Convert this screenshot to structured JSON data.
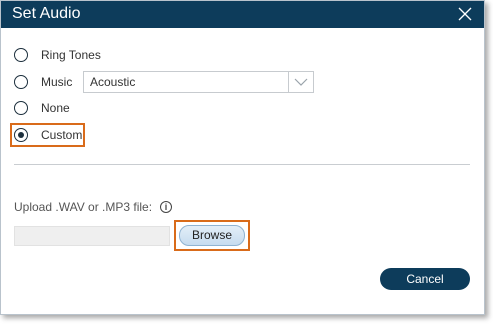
{
  "dialog": {
    "title": "Set Audio"
  },
  "options": {
    "ring_tones": "Ring Tones",
    "music": "Music",
    "none": "None",
    "custom": "Custom",
    "selected": "Custom"
  },
  "music_select": {
    "value": "Acoustic"
  },
  "upload": {
    "label": "Upload .WAV or .MP3 file:",
    "file_value": "",
    "browse_label": "Browse"
  },
  "footer": {
    "cancel_label": "Cancel"
  },
  "colors": {
    "title_bar": "#0d3c5b",
    "highlight": "#d96b1a",
    "cancel_button": "#0d3c5b"
  },
  "icons": {
    "close": "close-icon",
    "dropdown": "chevron-down-icon",
    "info": "info-icon"
  }
}
